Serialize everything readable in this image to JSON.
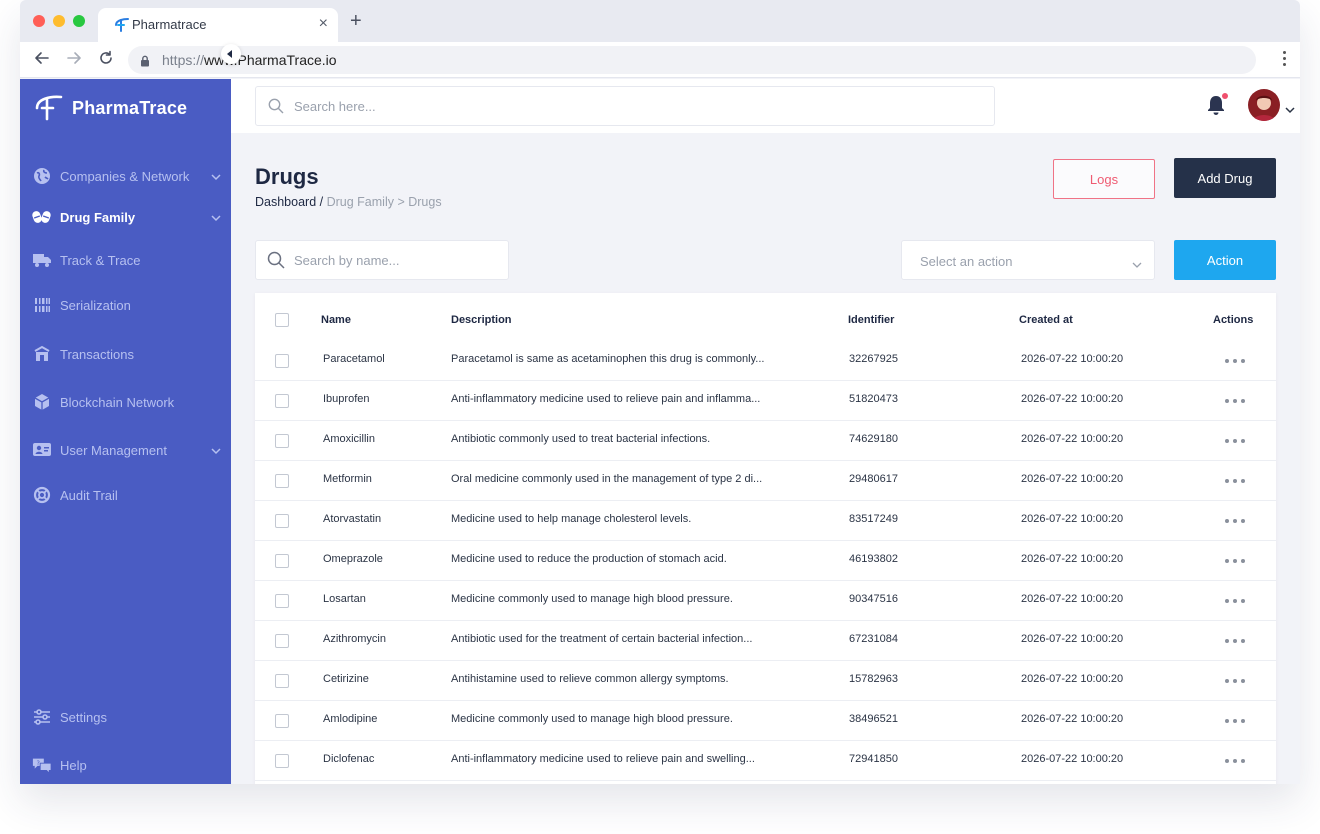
{
  "browser": {
    "tab_title": "Pharmatrace",
    "close_glyph": "×",
    "newtab_glyph": "+",
    "url_protocol": "https://",
    "url_host": "www.PharmaTrace.io"
  },
  "sidebar": {
    "brand": "PharmaTrace",
    "items": [
      {
        "label": "Companies & Network",
        "icon": "globe-icon",
        "has_chevron": true,
        "active": false
      },
      {
        "label": "Drug Family",
        "icon": "pills-icon",
        "has_chevron": true,
        "active": true
      },
      {
        "label": "Track & Trace",
        "icon": "truck-icon",
        "has_chevron": false,
        "active": false
      },
      {
        "label": "Serialization",
        "icon": "serialization-icon",
        "has_chevron": false,
        "active": false
      },
      {
        "label": "Transactions",
        "icon": "transactions-icon",
        "has_chevron": false,
        "active": false
      },
      {
        "label": "Blockchain Network",
        "icon": "cube-icon",
        "has_chevron": false,
        "active": false
      },
      {
        "label": "User Management",
        "icon": "user-management-icon",
        "has_chevron": true,
        "active": false
      },
      {
        "label": "Audit Trail",
        "icon": "lifebuoy-icon",
        "has_chevron": false,
        "active": false
      }
    ],
    "bottom_items": [
      {
        "label": "Settings",
        "icon": "sliders-icon"
      },
      {
        "label": "Help",
        "icon": "chat-help-icon"
      }
    ]
  },
  "topbar": {
    "search_placeholder": "Search here..."
  },
  "page": {
    "title": "Drugs",
    "breadcrumb": {
      "home": "Dashboard",
      "separator": "/",
      "trail": "Drug Family > Drugs"
    },
    "logs_button": "Logs",
    "add_button": "Add Drug",
    "name_search_placeholder": "Search by name...",
    "action_select_placeholder": "Select an action",
    "action_button": "Action"
  },
  "table": {
    "headers": {
      "name": "Name",
      "description": "Description",
      "identifier": "Identifier",
      "created_at": "Created at",
      "actions": "Actions"
    },
    "rows": [
      {
        "name": "Paracetamol",
        "description": "Paracetamol is same as acetaminophen this drug is commonly...",
        "identifier": "32267925",
        "created_at": "2026-07-22 10:00:20"
      },
      {
        "name": "Ibuprofen",
        "description": "Anti-inflammatory medicine used to relieve pain and inflamma...",
        "identifier": "51820473",
        "created_at": "2026-07-22 10:00:20"
      },
      {
        "name": "Amoxicillin",
        "description": "Antibiotic commonly used to treat bacterial infections.",
        "identifier": "74629180",
        "created_at": "2026-07-22 10:00:20"
      },
      {
        "name": "Metformin",
        "description": "Oral medicine commonly used in the management of type 2 di...",
        "identifier": "29480617",
        "created_at": "2026-07-22 10:00:20"
      },
      {
        "name": "Atorvastatin",
        "description": "Medicine used to help manage cholesterol levels.",
        "identifier": "83517249",
        "created_at": "2026-07-22 10:00:20"
      },
      {
        "name": "Omeprazole",
        "description": "Medicine used to reduce the production of stomach acid.",
        "identifier": "46193802",
        "created_at": "2026-07-22 10:00:20"
      },
      {
        "name": "Losartan",
        "description": "Medicine commonly used to manage high blood pressure.",
        "identifier": "90347516",
        "created_at": "2026-07-22 10:00:20"
      },
      {
        "name": "Azithromycin",
        "description": "Antibiotic used for the treatment of certain bacterial infection...",
        "identifier": "67231084",
        "created_at": "2026-07-22 10:00:20"
      },
      {
        "name": "Cetirizine",
        "description": "Antihistamine used to relieve common allergy symptoms.",
        "identifier": "15782963",
        "created_at": "2026-07-22 10:00:20"
      },
      {
        "name": "Amlodipine",
        "description": "Medicine commonly used to manage high blood pressure.",
        "identifier": "38496521",
        "created_at": "2026-07-22 10:00:20"
      },
      {
        "name": "Diclofenac",
        "description": "Anti-inflammatory medicine used to relieve pain and swelling...",
        "identifier": "72941850",
        "created_at": "2026-07-22 10:00:20"
      }
    ]
  },
  "colors": {
    "sidebar": "#4a5cc3",
    "primary_dark": "#253149",
    "accent_blue": "#1ea7ef",
    "danger": "#ef5b72"
  }
}
